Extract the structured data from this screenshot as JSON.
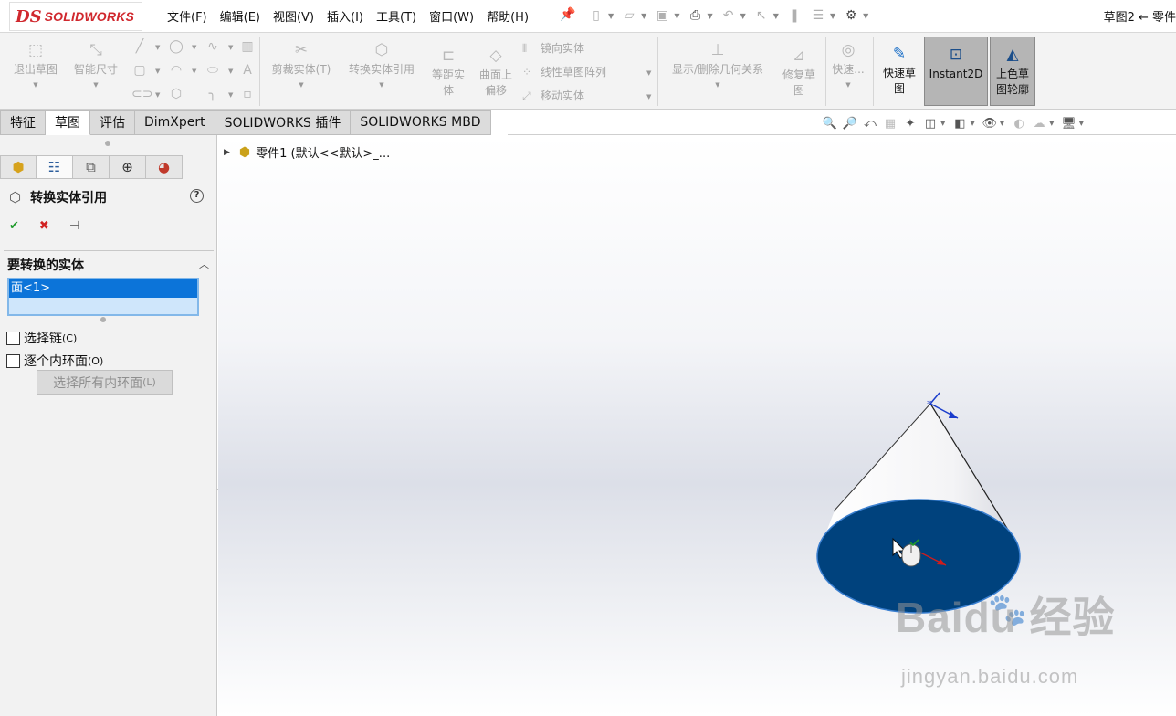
{
  "app": {
    "logo_ds": "DS",
    "logo_text": "SOLIDWORKS",
    "doc_title": "草图2 ← 零件"
  },
  "menu": [
    "文件(F)",
    "编辑(E)",
    "视图(V)",
    "插入(I)",
    "工具(T)",
    "窗口(W)",
    "帮助(H)"
  ],
  "toolbar": {
    "exit_sketch": "退出草图",
    "smart_dim": "智能尺寸",
    "trim": "剪裁实体(T)",
    "convert": "转换实体引用",
    "offset_1": "等距实",
    "offset_2": "体",
    "surf_offset_1": "曲面上",
    "surf_offset_2": "偏移",
    "mirror": "镜向实体",
    "linear_pattern": "线性草图阵列",
    "move": "移动实体",
    "relations": "显示/删除几何关系",
    "repair_1": "修复草",
    "repair_2": "图",
    "quick_snap": "快速...",
    "rapid_sketch_1": "快速草",
    "rapid_sketch_2": "图",
    "instant2d": "Instant2D",
    "shaded_1": "上色草",
    "shaded_2": "图轮廓"
  },
  "tabs": [
    "特征",
    "草图",
    "评估",
    "DimXpert",
    "SOLIDWORKS 插件",
    "SOLIDWORKS MBD"
  ],
  "active_tab": "草图",
  "feature_tree": {
    "part_label": "零件1  (默认<<默认>_..."
  },
  "property_manager": {
    "title": "转换实体引用",
    "help": "?",
    "group_title": "要转换的实体",
    "selection_items": [
      "面<1>"
    ],
    "select_chain_label": "选择链",
    "select_chain_key": "(C)",
    "select_chain_checked": false,
    "inner_loops_label": "逐个内环面",
    "inner_loops_key": "(O)",
    "inner_loops_checked": false,
    "select_all_loops_label": "选择所有内环面",
    "select_all_loops_key": "(L)"
  },
  "watermark": {
    "main": "Baidu 经验",
    "sub": "jingyan.baidu.com"
  },
  "colors": {
    "accent_red": "#d0282e",
    "selection_blue": "#0c74d9",
    "cone_base": "#00427d",
    "ok_green": "#1f9a2b",
    "cancel_red": "#d12323"
  }
}
